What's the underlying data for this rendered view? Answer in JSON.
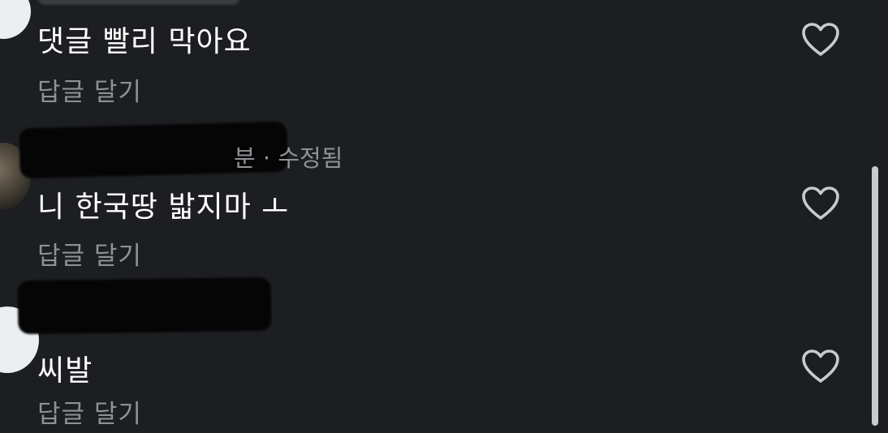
{
  "comments": [
    {
      "username": "",
      "meta": "",
      "text": "댓글 빨리 막아요",
      "reply_label": "답글 달기",
      "like_icon": "heart-outline-icon"
    },
    {
      "username": "",
      "meta": "분 · 수정됨",
      "text": "니 한국땅 밟지마 ㅗ",
      "reply_label": "답글 달기",
      "like_icon": "heart-outline-icon"
    },
    {
      "username": "",
      "meta": "",
      "text": "씨발",
      "reply_label": "답글 달기",
      "like_icon": "heart-outline-icon"
    }
  ],
  "colors": {
    "background": "#1c1e21",
    "text_primary": "#ffffff",
    "text_secondary": "#8e9196",
    "icon": "#c9cacc"
  }
}
